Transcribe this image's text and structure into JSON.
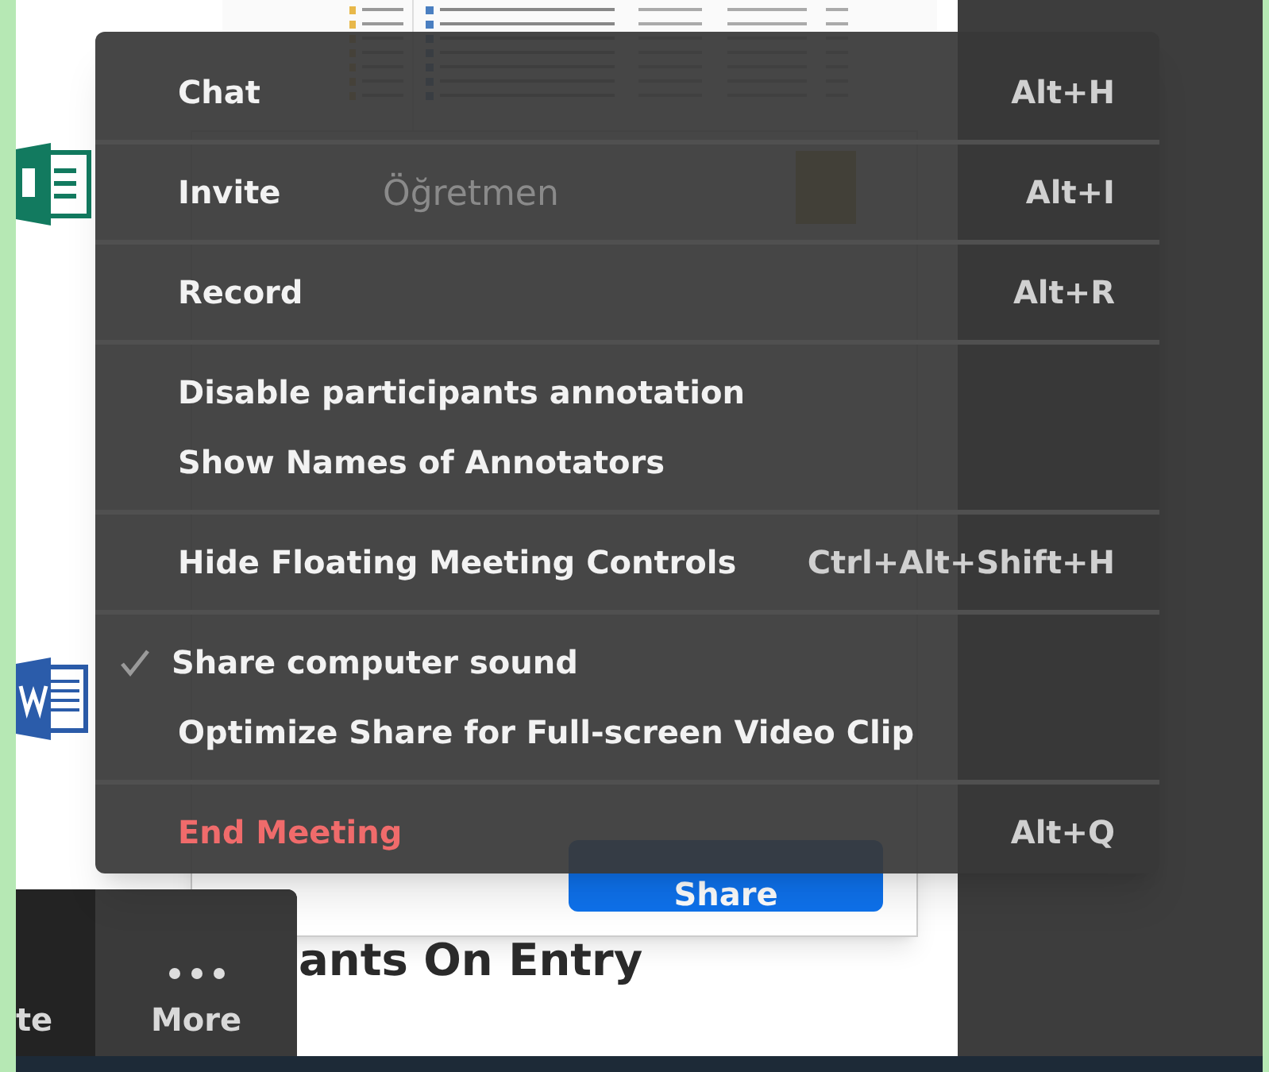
{
  "shared_screen": {
    "teacher_label": "Öğretmen",
    "share_button": "Share",
    "heading": "ants On Entry"
  },
  "toolbar": {
    "items": [
      {
        "label": "te",
        "kind": "cut"
      },
      {
        "label": "More",
        "kind": "more"
      }
    ]
  },
  "menu": {
    "sections": [
      {
        "items": [
          {
            "label": "Chat",
            "shortcut": "Alt+H",
            "kind": "item"
          }
        ]
      },
      {
        "items": [
          {
            "label": "Invite",
            "shortcut": "Alt+I",
            "kind": "item"
          }
        ]
      },
      {
        "items": [
          {
            "label": "Record",
            "shortcut": "Alt+R",
            "kind": "item"
          }
        ]
      },
      {
        "items": [
          {
            "label": "Disable participants annotation",
            "kind": "item"
          },
          {
            "label": "Show Names of Annotators",
            "kind": "item"
          }
        ]
      },
      {
        "items": [
          {
            "label": "Hide Floating Meeting Controls",
            "shortcut": "Ctrl+Alt+Shift+H",
            "kind": "item"
          }
        ]
      },
      {
        "items": [
          {
            "label": "Share computer sound",
            "kind": "item",
            "checked": true
          },
          {
            "label": "Optimize Share for Full-screen Video Clip",
            "kind": "item",
            "checked": false
          }
        ]
      },
      {
        "items": [
          {
            "label": "End Meeting",
            "shortcut": "Alt+Q",
            "kind": "danger"
          }
        ]
      }
    ]
  }
}
